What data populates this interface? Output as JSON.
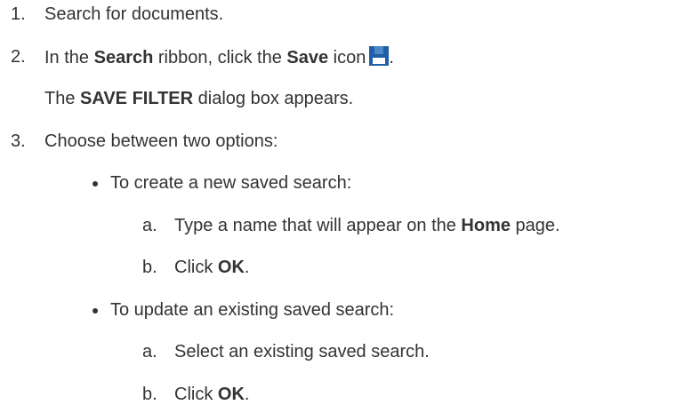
{
  "steps": [
    {
      "num": "1.",
      "text": "Search for documents."
    },
    {
      "num": "2.",
      "pre": "In the ",
      "bold1": "Search",
      "mid": " ribbon, click the ",
      "bold2": "Save",
      "post": " icon",
      "end": ".",
      "icon": "save-icon",
      "result_pre": "The ",
      "result_bold": "SAVE FILTER",
      "result_post": " dialog box appears."
    },
    {
      "num": "3.",
      "text": "Choose between two options:",
      "options": [
        {
          "text": "To create a new saved search:",
          "substeps": [
            {
              "letter": "a.",
              "pre": "Type a name that will appear on the ",
              "bold": "Home",
              "post": " page."
            },
            {
              "letter": "b.",
              "pre": "Click ",
              "bold": "OK",
              "post": "."
            }
          ]
        },
        {
          "text": "To update an existing saved search:",
          "substeps": [
            {
              "letter": "a.",
              "pre": "Select an existing saved search.",
              "bold": "",
              "post": ""
            },
            {
              "letter": "b.",
              "pre": "Click ",
              "bold": "OK",
              "post": "."
            }
          ]
        }
      ]
    }
  ],
  "colors": {
    "text": "#333333",
    "icon_primary": "#1f5fa8"
  }
}
